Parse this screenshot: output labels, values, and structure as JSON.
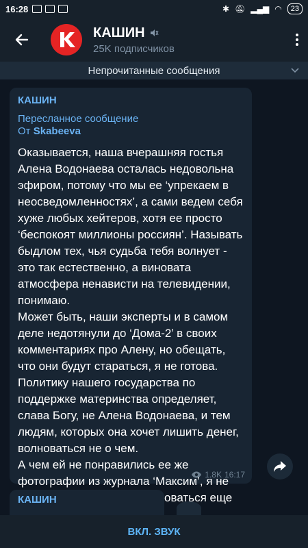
{
  "status_bar": {
    "time": "16:28",
    "battery": "23"
  },
  "header": {
    "title": "КАШИН",
    "subtitle": "25K подписчиков"
  },
  "unread_banner": "Непрочитанные сообщения",
  "message": {
    "author": "КАШИН",
    "forwarded_label": "Пересланное сообщение",
    "from_prefix": "От",
    "from_name": "Skabeeva",
    "paragraphs": [
      "Оказывается, наша вчерашняя гостья Алена Водонаева осталась недовольна эфиром, потому что мы ее ‘упрекаем в неосведомленностях’, а сами ведем себя хуже любых хейтеров, хотя ее просто ‘беспокоят миллионы россиян’. Называть быдлом тех, чья судьба тебя волнует - это так естественно, а виновата атмосфера ненависти на телевидении, понимаю.",
      "Может быть, наши эксперты и в самом деле недотянули до ‘Дома-2’ в своих комментариях про Алену, но обещать, что они будут стараться, я не готова.",
      "Политику нашего государства по поддержке материнства определяет, слава Богу, не Алена Водонаева, и тем людям, которых она хочет лишить денег, волноваться не о чем.",
      "А чем ей не понравились ее же фотографии из журнала ‘Максим’, я не знаю. Можно сфотографироваться еще раз, если проблема в них."
    ],
    "views": "1.8K",
    "time": "16:17"
  },
  "next_message": {
    "author": "КАШИН"
  },
  "bottom_bar": {
    "unmute_label": "ВКЛ. ЗВУК"
  }
}
